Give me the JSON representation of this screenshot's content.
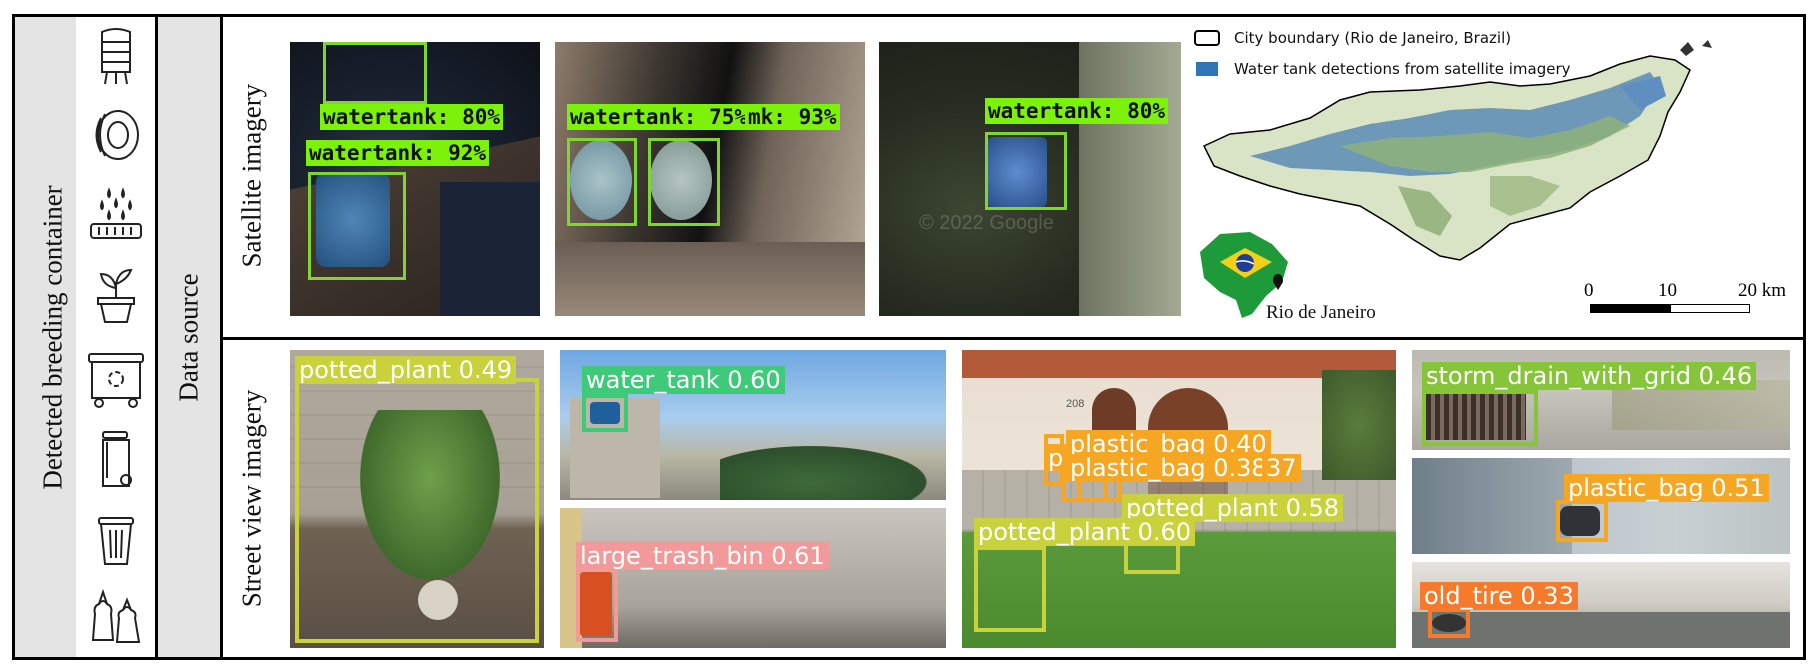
{
  "labels": {
    "detected_breeding_container": "Detected breeding container",
    "data_source": "Data source",
    "satellite_imagery": "Satellite imagery",
    "street_view_imagery": "Street view imagery"
  },
  "icons": [
    "water-tower-icon",
    "tire-icon",
    "storm-drain-icon",
    "potted-plant-icon",
    "large-trash-bin-icon",
    "trash-bin-icon",
    "small-trash-can-icon",
    "plastic-bag-icon"
  ],
  "satellite": {
    "tile1": {
      "label_a": "watertank: 80%",
      "label_b": "watertank: 92%"
    },
    "tile2": {
      "label_a": "watertank: 75%",
      "label_b": "mk: 93%"
    },
    "tile3": {
      "label_a": "watertank: 80%",
      "watermark": "© 2022 Google"
    },
    "map": {
      "legend_boundary": "City boundary (Rio de Janeiro, Brazil)",
      "legend_detections": "Water tank detections from satellite imagery",
      "inset_label": "Rio de Janeiro",
      "scale_0": "0",
      "scale_10": "10",
      "scale_20": "20 km"
    }
  },
  "street": {
    "img1": {
      "label": "potted_plant 0.49"
    },
    "img2": {
      "label": "water_tank 0.60"
    },
    "img3": {
      "label": "large_trash_bin 0.61"
    },
    "img4": {
      "label_bag1": "plastic_bag 0.40",
      "label_bag2": "plastic_bag 0.38",
      "label_bag_frag1": "p",
      "label_bag_frag2": "37",
      "label_plant1": "potted_plant 0.58",
      "label_plant2": "potted_plant 0.60",
      "house_number": "208"
    },
    "img5": {
      "label": "storm_drain_with_grid 0.46"
    },
    "img6": {
      "label": "plastic_bag 0.51"
    },
    "img7": {
      "label": "old_tire 0.33"
    }
  },
  "colors": {
    "potted_plant": "#c9d13c",
    "water_tank": "#3fca7a",
    "large_trash_bin": "#f29a9a",
    "plastic_bag": "#f5a623",
    "storm_drain": "#86c43a",
    "old_tire": "#f57a2c",
    "sat_box": "#7fd62f",
    "sat_label": "#7cf20a",
    "detections": "#2f76b8"
  }
}
